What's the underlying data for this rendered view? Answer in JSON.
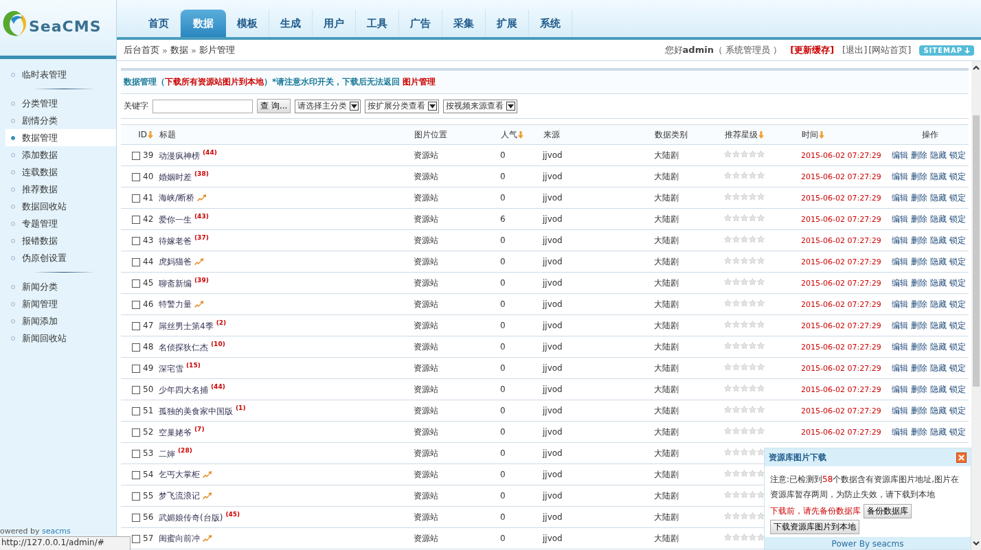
{
  "logo": {
    "text": "SeaCMS"
  },
  "nav": [
    {
      "label": "首页",
      "selected": false
    },
    {
      "label": "数据",
      "selected": true
    },
    {
      "label": "模板",
      "selected": false
    },
    {
      "label": "生成",
      "selected": false
    },
    {
      "label": "用户",
      "selected": false
    },
    {
      "label": "工具",
      "selected": false
    },
    {
      "label": "广告",
      "selected": false
    },
    {
      "label": "采集",
      "selected": false
    },
    {
      "label": "扩展",
      "selected": false
    },
    {
      "label": "系统",
      "selected": false
    }
  ],
  "breadcrumb": [
    {
      "text": "后台首页"
    },
    {
      "separator": "»",
      "text": "数据"
    },
    {
      "separator": "»",
      "text": "影片管理"
    }
  ],
  "user_bar": {
    "greeting": "您好**admin**（ 系统管理员 ）",
    "refresh": "[更新缓存]",
    "links": [
      "[退出]",
      "[网站首页]"
    ],
    "sitemap": "SITEMAP"
  },
  "sidebar": {
    "groups": [
      [
        {
          "label": "临时表管理",
          "selected": false
        }
      ],
      [
        {
          "label": "分类管理",
          "selected": false
        },
        {
          "label": "剧情分类",
          "selected": false
        },
        {
          "label": "数据管理",
          "selected": true
        },
        {
          "label": "添加数据",
          "selected": false
        },
        {
          "label": "连载数据",
          "selected": false
        },
        {
          "label": "推荐数据",
          "selected": false
        },
        {
          "label": "数据回收站",
          "selected": false
        },
        {
          "label": "专题管理",
          "selected": false
        },
        {
          "label": "报错数据",
          "selected": false
        },
        {
          "label": "伪原创设置",
          "selected": false
        }
      ],
      [
        {
          "label": "新闻分类",
          "selected": false
        },
        {
          "label": "新闻管理",
          "selected": false
        },
        {
          "label": "新闻添加",
          "selected": false
        },
        {
          "label": "新闻回收站",
          "selected": false
        }
      ]
    ],
    "footer_prefix": "owered by",
    "footer_link": "seacms"
  },
  "heading": [
    {
      "kind": "text",
      "text": "数据管理（"
    },
    {
      "kind": "link",
      "text": "下载所有资源站图片到本地"
    },
    {
      "kind": "text",
      "text": "）*请注意水印开关，下载后无法返回 "
    },
    {
      "kind": "link",
      "text": "图片管理"
    }
  ],
  "search": {
    "label": "关键字",
    "button": "查 询...",
    "selects": [
      "请选择主分类",
      "按扩展分类查看",
      "按视频来源查看"
    ]
  },
  "table": {
    "columns": [
      {
        "label": "ID",
        "sortable": true
      },
      {
        "label": "标题",
        "sortable": false
      },
      {
        "label": "图片位置",
        "sortable": false
      },
      {
        "label": "人气",
        "sortable": true
      },
      {
        "label": "来源",
        "sortable": false
      },
      {
        "label": "数据类别",
        "sortable": false
      },
      {
        "label": "推荐星级",
        "sortable": true
      },
      {
        "label": "时间",
        "sortable": true
      },
      {
        "label": "操作",
        "sortable": false
      }
    ],
    "rows": [
      {
        "checked": false,
        "id": "39",
        "title": "动漫疯神榜",
        "count": "(44)",
        "hot": false,
        "image": "资源站",
        "views": "0",
        "source": "jjvod",
        "category": "大陆剧",
        "stars": 0,
        "time": "2015-06-02 07:27:29",
        "actions": [
          "编辑",
          "删除",
          "隐藏",
          "锁定"
        ]
      },
      {
        "checked": false,
        "id": "40",
        "title": "婚姻时差",
        "count": "(38)",
        "hot": false,
        "image": "资源站",
        "views": "0",
        "source": "jjvod",
        "category": "大陆剧",
        "stars": 0,
        "time": "2015-06-02 07:27:29",
        "actions": [
          "编辑",
          "删除",
          "隐藏",
          "锁定"
        ]
      },
      {
        "checked": false,
        "id": "41",
        "title": "海峡/断桥",
        "hot": true,
        "image": "资源站",
        "views": "0",
        "source": "jjvod",
        "category": "大陆剧",
        "stars": 0,
        "time": "2015-06-02 07:27:29",
        "actions": [
          "编辑",
          "删除",
          "隐藏",
          "锁定"
        ]
      },
      {
        "checked": false,
        "id": "42",
        "title": "爱你一生",
        "count": "(43)",
        "hot": false,
        "image": "资源站",
        "views": "6",
        "source": "jjvod",
        "category": "大陆剧",
        "stars": 0,
        "time": "2015-06-02 07:27:29",
        "actions": [
          "编辑",
          "删除",
          "隐藏",
          "锁定"
        ]
      },
      {
        "checked": false,
        "id": "43",
        "title": "待嫁老爸",
        "count": "(37)",
        "hot": false,
        "image": "资源站",
        "views": "0",
        "source": "jjvod",
        "category": "大陆剧",
        "stars": 0,
        "time": "2015-06-02 07:27:29",
        "actions": [
          "编辑",
          "删除",
          "隐藏",
          "锁定"
        ]
      },
      {
        "checked": false,
        "id": "44",
        "title": "虎妈猫爸",
        "hot": true,
        "image": "资源站",
        "views": "0",
        "source": "jjvod",
        "category": "大陆剧",
        "stars": 0,
        "time": "2015-06-02 07:27:29",
        "actions": [
          "编辑",
          "删除",
          "隐藏",
          "锁定"
        ]
      },
      {
        "checked": false,
        "id": "45",
        "title": "聊斋新编",
        "count": "(39)",
        "hot": false,
        "image": "资源站",
        "views": "0",
        "source": "jjvod",
        "category": "大陆剧",
        "stars": 0,
        "time": "2015-06-02 07:27:29",
        "actions": [
          "编辑",
          "删除",
          "隐藏",
          "锁定"
        ]
      },
      {
        "checked": false,
        "id": "46",
        "title": "特警力量",
        "hot": true,
        "image": "资源站",
        "views": "0",
        "source": "jjvod",
        "category": "大陆剧",
        "stars": 0,
        "time": "2015-06-02 07:27:29",
        "actions": [
          "编辑",
          "删除",
          "隐藏",
          "锁定"
        ]
      },
      {
        "checked": false,
        "id": "47",
        "title": "屌丝男士第4季",
        "count": "(2)",
        "hot": false,
        "image": "资源站",
        "views": "0",
        "source": "jjvod",
        "category": "大陆剧",
        "stars": 0,
        "time": "2015-06-02 07:27:29",
        "actions": [
          "编辑",
          "删除",
          "隐藏",
          "锁定"
        ]
      },
      {
        "checked": false,
        "id": "48",
        "title": "名侦探狄仁杰",
        "count": "(10)",
        "hot": false,
        "image": "资源站",
        "views": "0",
        "source": "jjvod",
        "category": "大陆剧",
        "stars": 0,
        "time": "2015-06-02 07:27:29",
        "actions": [
          "编辑",
          "删除",
          "隐藏",
          "锁定"
        ]
      },
      {
        "checked": false,
        "id": "49",
        "title": "深宅雪",
        "count": "(15)",
        "hot": false,
        "image": "资源站",
        "views": "0",
        "source": "jjvod",
        "category": "大陆剧",
        "stars": 0,
        "time": "2015-06-02 07:27:29",
        "actions": [
          "编辑",
          "删除",
          "隐藏",
          "锁定"
        ]
      },
      {
        "checked": false,
        "id": "50",
        "title": "少年四大名捕",
        "count": "(44)",
        "hot": false,
        "image": "资源站",
        "views": "0",
        "source": "jjvod",
        "category": "大陆剧",
        "stars": 0,
        "time": "2015-06-02 07:27:29",
        "actions": [
          "编辑",
          "删除",
          "隐藏",
          "锁定"
        ]
      },
      {
        "checked": false,
        "id": "51",
        "title": "孤独的美食家中国版",
        "count": "(1)",
        "hot": false,
        "image": "资源站",
        "views": "0",
        "source": "jjvod",
        "category": "大陆剧",
        "stars": 0,
        "time": "2015-06-02 07:27:29",
        "actions": [
          "编辑",
          "删除",
          "隐藏",
          "锁定"
        ]
      },
      {
        "checked": false,
        "id": "52",
        "title": "空巢姥爷",
        "count": "(7)",
        "hot": false,
        "image": "资源站",
        "views": "0",
        "source": "jjvod",
        "category": "大陆剧",
        "stars": 0,
        "time": "2015-06-02 07:27:29",
        "actions": [
          "编辑",
          "删除",
          "隐藏",
          "锁定"
        ]
      },
      {
        "checked": false,
        "id": "53",
        "title": "二婶",
        "count": "(28)",
        "hot": false,
        "image": "资源站",
        "views": "0",
        "source": "jjvod",
        "category": "大陆剧",
        "stars": 0
      },
      {
        "checked": false,
        "id": "54",
        "title": "乞丐大掌柜",
        "hot": true,
        "image": "资源站",
        "views": "0",
        "source": "jjvod",
        "category": "大陆剧",
        "stars": 0
      },
      {
        "checked": false,
        "id": "55",
        "title": "梦飞流浪记",
        "hot": true,
        "image": "资源站",
        "views": "0",
        "source": "jjvod",
        "category": "大陆剧",
        "stars": 0
      },
      {
        "checked": false,
        "id": "56",
        "title": "武媚娘传奇(台版)",
        "count": "(45)",
        "hot": false,
        "image": "资源站",
        "views": "0",
        "source": "jjvod",
        "category": "大陆剧",
        "stars": 0
      },
      {
        "checked": false,
        "id": "57",
        "title": "闺蜜向前冲",
        "hot": true,
        "image": "资源站",
        "views": "0",
        "source": "jjvod",
        "category": "大陆剧",
        "stars": 0
      }
    ]
  },
  "popup": {
    "title": "资源库图片下载",
    "notice_before": "注意:已检测到",
    "notice_count": "58",
    "notice_after": "个数据含有资源库图片地址,图片在资源库暂存两周，为防止失效，请下载到本地",
    "warning": "下载前，请先备份数据库",
    "backup_button": "备份数据库",
    "download_button": "下载资源库图片到本地",
    "footer": "Power By seacms"
  },
  "status_bar": "http://127.0.0.1/admin/#"
}
